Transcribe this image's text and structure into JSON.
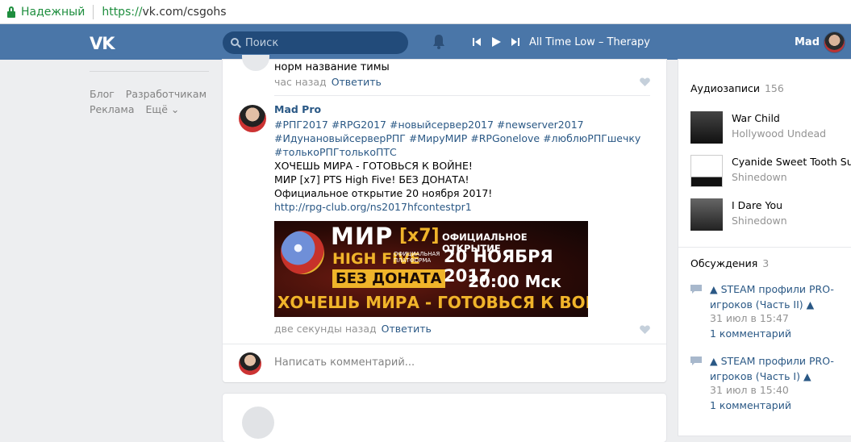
{
  "browser": {
    "secure_label": "Надежный",
    "url_scheme": "https://",
    "url_host": "vk.com/csgohs"
  },
  "header": {
    "logo": "VK",
    "search_placeholder": "Поиск",
    "track": "All Time Low – Therapy",
    "user_name": "Mad",
    "bg_color": "#4a76a8"
  },
  "left_nav": {
    "row1": [
      "Блог",
      "Разработчикам"
    ],
    "row2": [
      "Реклама",
      "Ещё"
    ]
  },
  "feed": {
    "comment1": {
      "text": "норм название тимы",
      "time": "час назад",
      "reply": "Ответить"
    },
    "post": {
      "author": "Mad Pro",
      "tags_line1": "#РПГ2017 #RPG2017 #новыйсервер2017 #newserver2017",
      "tags_line2": "#ИдунановыйсерверРПГ #МируМИР #RPGonelove #люблюРПГшечку",
      "tags_line3": "#толькоРПГтолькоПТС",
      "line1": "ХОЧЕШЬ МИРА - ГОТОВЬСЯ К ВОЙНЕ!",
      "line2": "МИР [x7] PTS High Five! БЕЗ ДОНАТА!",
      "line3": "Официальное открытие 20 ноября 2017!",
      "link": "http://rpg-club.org/ns2017hfcontestpr1",
      "banner": {
        "mir": "МИР",
        "x7": "[x7]",
        "high_five": "HIGH FIVE",
        "platform": "ОФИЦИАЛЬНАЯ ПЛАТФОРМА",
        "no_donate": "БЕЗ ДОНАТА",
        "official_open": "ОФИЦИАЛЬНОЕ ОТКРЫТИЕ",
        "date": "20 НОЯБРЯ 2017",
        "time": "20:00 Мск",
        "slogan": "ХОЧЕШЬ МИРА - ГОТОВЬСЯ К ВОЙНЕ"
      },
      "time": "две секунды назад",
      "reply": "Ответить"
    },
    "comment_placeholder": "Написать комментарий..."
  },
  "sidebar": {
    "audio": {
      "title": "Аудиозаписи",
      "count": "156",
      "items": [
        {
          "name": "War Child",
          "artist": "Hollywood Undead"
        },
        {
          "name": "Cyanide Sweet Tooth Suicide",
          "artist": "Shinedown"
        },
        {
          "name": "I Dare You",
          "artist": "Shinedown"
        }
      ]
    },
    "discussions": {
      "title": "Обсуждения",
      "count": "3",
      "items": [
        {
          "title": "▲ STEAM профили PRO-игроков (Часть II) ▲",
          "date": "31 июл в 15:47",
          "comments": "1 комментарий"
        },
        {
          "title": "▲ STEAM профили PRO-игроков (Часть I) ▲",
          "date": "31 июл в 15:40",
          "comments": "1 комментарий"
        }
      ]
    }
  }
}
